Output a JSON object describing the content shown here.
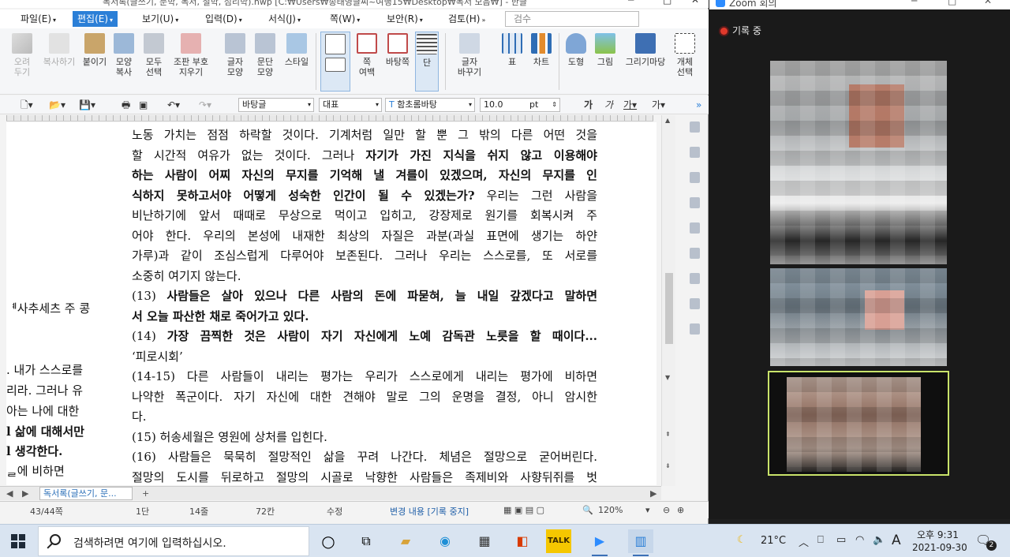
{
  "hwp": {
    "title": "독서록(글쓰기, 문학, 독서, 철학, 심리학).hwp [C:₩Users₩송태영글씨~여행15₩Desktop₩독서 모음₩] - 한글",
    "menus": [
      "파일(E)",
      "편집(E)",
      "보기(U)",
      "입력(D)",
      "서식(J)",
      "쪽(W)",
      "보안(R)",
      "검토(H)"
    ],
    "search_placeholder": "검수",
    "ribbon": [
      {
        "label": "오려\n두기",
        "icon": "scissors-icon"
      },
      {
        "label": "복사하기",
        "icon": "copy-icon"
      },
      {
        "label": "붙이기",
        "icon": "paste-icon"
      },
      {
        "label": "모양\n복사",
        "icon": "format-copy-icon"
      },
      {
        "label": "모두\n선택",
        "icon": "select-all-icon"
      },
      {
        "label": "조판 부호\n지우기",
        "icon": "erase-code-icon"
      },
      {
        "label": "글자\n모양",
        "icon": "char-shape-icon"
      },
      {
        "label": "문단\n모양",
        "icon": "para-shape-icon"
      },
      {
        "label": "스타일",
        "icon": "style-icon"
      },
      {
        "label": "",
        "icon": "page-icon"
      },
      {
        "label": "쪽\n여백",
        "icon": "margin-icon"
      },
      {
        "label": "바탕쪽",
        "icon": "master-page-icon"
      },
      {
        "label": "단",
        "icon": "column-icon"
      },
      {
        "label": "글자\n바꾸기",
        "icon": "replace-icon"
      },
      {
        "label": "표",
        "icon": "table-icon"
      },
      {
        "label": "차트",
        "icon": "chart-icon"
      },
      {
        "label": "도형",
        "icon": "shape-icon"
      },
      {
        "label": "그림",
        "icon": "picture-icon"
      },
      {
        "label": "그리기마당",
        "icon": "drawing-icon"
      },
      {
        "label": "개체\n선택",
        "icon": "select-object-icon"
      }
    ],
    "style_select": "바탕글",
    "lang_select": "대표",
    "font_select": "함초롬바탕",
    "size_value": "10.0",
    "size_unit": "pt",
    "left_fragment": [
      {
        "text": "ᅨ사추세츠 주 콩",
        "bold": false
      },
      {
        "text": ". 내가 스스로를",
        "bold": false
      },
      {
        "text": "리라. 그러나 유",
        "bold": false
      },
      {
        "text": " 아는 나에 대한",
        "bold": false
      },
      {
        "text": "l 삶에 대해서만",
        "bold": true
      },
      {
        "text": "l 생각한다.",
        "bold": true
      },
      {
        "text": "ᆯ에 비하면",
        "bold": false
      }
    ],
    "doc_lines": [
      [
        {
          "t": "노동 가치는 점점 하락할 것이다. 기계처럼 일만 할 뿐 그 밖의 다른 어떤 것을",
          "b": false
        }
      ],
      [
        {
          "t": "할 시간적 여유가 없는 것이다. 그러나 ",
          "b": false
        },
        {
          "t": "자기가 가진 지식을 쉬지 않고 이용해야",
          "b": true
        }
      ],
      [
        {
          "t": "하는 사람이 어찌 자신의 무지를 기억해 낼 겨를이 있겠으며, 자신의 무지를 인",
          "b": true
        }
      ],
      [
        {
          "t": "식하지 못하고서야 어떻게 성숙한 인간이 될 수 있겠는가?",
          "b": true
        },
        {
          "t": " 우리는 그런 사람을",
          "b": false
        }
      ],
      [
        {
          "t": "비난하기에 앞서 때때로 무상으로 먹이고 입히고, 강장제로 원기를 회복시켜 주",
          "b": false
        }
      ],
      [
        {
          "t": "어야 한다. 우리의 본성에 내재한 최상의 자질은 과분(과실 표면에 생기는 하얀",
          "b": false
        }
      ],
      [
        {
          "t": "가루)과 같이 조심스럽게 다루어야 보존된다. 그러나 우리는 스스로를, 또 서로를",
          "b": false
        }
      ],
      [
        {
          "t": "소중히 여기지 않는다.",
          "b": false
        }
      ],
      [
        {
          "t": "(13) ",
          "b": false
        },
        {
          "t": "사람들은 살아 있으나 다른 사람의 돈에 파묻혀, 늘 내일 갚겠다고 말하면",
          "b": true
        }
      ],
      [
        {
          "t": "서 오늘 파산한 채로 죽어가고 있다.",
          "b": true
        }
      ],
      [
        {
          "t": "(14) ",
          "b": false
        },
        {
          "t": "가장 끔찍한 것은 사람이 자기 자신에게 노예 감독관 노릇을 할 때이다...",
          "b": true
        }
      ],
      [
        {
          "t": "‘피로시회’",
          "b": false
        }
      ],
      [
        {
          "t": "(14-15) 다른 사람들이 내리는 평가는 우리가 스스로에게 내리는 평가에 비하면",
          "b": false
        }
      ],
      [
        {
          "t": "나약한 폭군이다. 자기 자신에 대한 견해야 말로 그의 운명을 결정, 아니 암시한",
          "b": false
        }
      ],
      [
        {
          "t": "다.",
          "b": false
        }
      ],
      [
        {
          "t": "(15) 허송세월은 영원에 상처를 입힌다.",
          "b": false
        }
      ],
      [
        {
          "t": "(16) 사람들은 묵묵히 절망적인 삶을 꾸려 나간다. 체념은 절망으로 굳어버린다.",
          "b": false
        }
      ],
      [
        {
          "t": "절망의 도시를 뒤로하고 절망의 시골로 낙향한 사람들은 족제비와 사향뒤쥐를 벗",
          "b": false
        }
      ]
    ],
    "doc_tab": "독서록(글쓰기, 문...",
    "status": {
      "page": "43/44쪽",
      "section": "1단",
      "line": "14줄",
      "col": "72칸",
      "mode": "수정",
      "track": "변경 내용 [기록 중지]",
      "zoom": "120%"
    }
  },
  "zoom": {
    "title": "Zoom 회의",
    "recording": "기록 중"
  },
  "taskbar": {
    "search_placeholder": "검색하려면 여기에 입력하십시오.",
    "weather": "21°C",
    "time": "오후 9:31",
    "date": "2021-09-30",
    "notif_count": "2",
    "ime": "A"
  }
}
